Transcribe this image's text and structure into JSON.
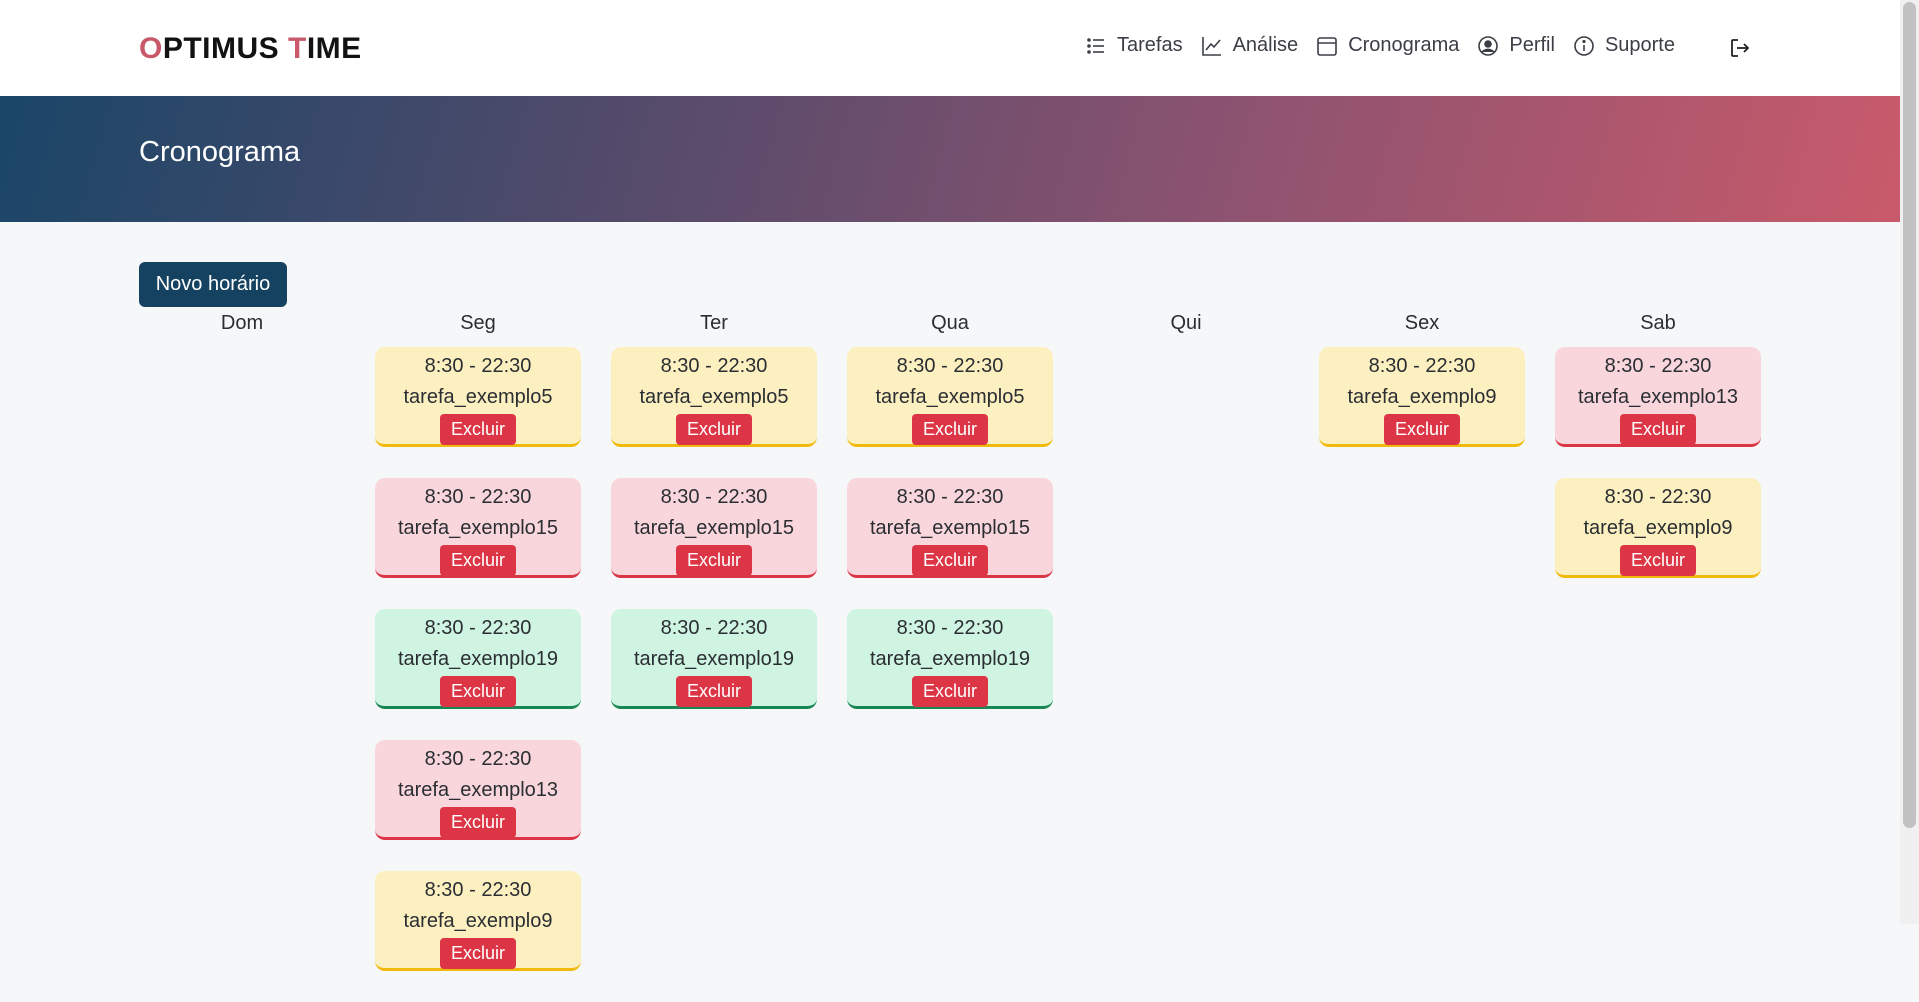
{
  "brand": {
    "first_letter": "O",
    "rest1": "PTIMUS ",
    "second_letter": "T",
    "rest2": "IME"
  },
  "nav": {
    "tasks": "Tarefas",
    "analysis": "Análise",
    "schedule": "Cronograma",
    "profile": "Perfil",
    "support": "Suporte"
  },
  "page_title": "Cronograma",
  "new_button": "Novo horário",
  "delete_label": "Excluir",
  "days": [
    {
      "name": "Dom",
      "entries": []
    },
    {
      "name": "Seg",
      "entries": [
        {
          "time": "8:30 - 22:30",
          "task": "tarefa_exemplo5",
          "color": "yellow"
        },
        {
          "time": "8:30 - 22:30",
          "task": "tarefa_exemplo15",
          "color": "red"
        },
        {
          "time": "8:30 - 22:30",
          "task": "tarefa_exemplo19",
          "color": "green"
        },
        {
          "time": "8:30 - 22:30",
          "task": "tarefa_exemplo13",
          "color": "red"
        },
        {
          "time": "8:30 - 22:30",
          "task": "tarefa_exemplo9",
          "color": "yellow"
        }
      ]
    },
    {
      "name": "Ter",
      "entries": [
        {
          "time": "8:30 - 22:30",
          "task": "tarefa_exemplo5",
          "color": "yellow"
        },
        {
          "time": "8:30 - 22:30",
          "task": "tarefa_exemplo15",
          "color": "red"
        },
        {
          "time": "8:30 - 22:30",
          "task": "tarefa_exemplo19",
          "color": "green"
        }
      ]
    },
    {
      "name": "Qua",
      "entries": [
        {
          "time": "8:30 - 22:30",
          "task": "tarefa_exemplo5",
          "color": "yellow"
        },
        {
          "time": "8:30 - 22:30",
          "task": "tarefa_exemplo15",
          "color": "red"
        },
        {
          "time": "8:30 - 22:30",
          "task": "tarefa_exemplo19",
          "color": "green"
        }
      ]
    },
    {
      "name": "Qui",
      "entries": []
    },
    {
      "name": "Sex",
      "entries": [
        {
          "time": "8:30 - 22:30",
          "task": "tarefa_exemplo9",
          "color": "yellow"
        }
      ]
    },
    {
      "name": "Sab",
      "entries": [
        {
          "time": "8:30 - 22:30",
          "task": "tarefa_exemplo13",
          "color": "red"
        },
        {
          "time": "8:30 - 22:30",
          "task": "tarefa_exemplo9",
          "color": "yellow"
        }
      ]
    }
  ]
}
